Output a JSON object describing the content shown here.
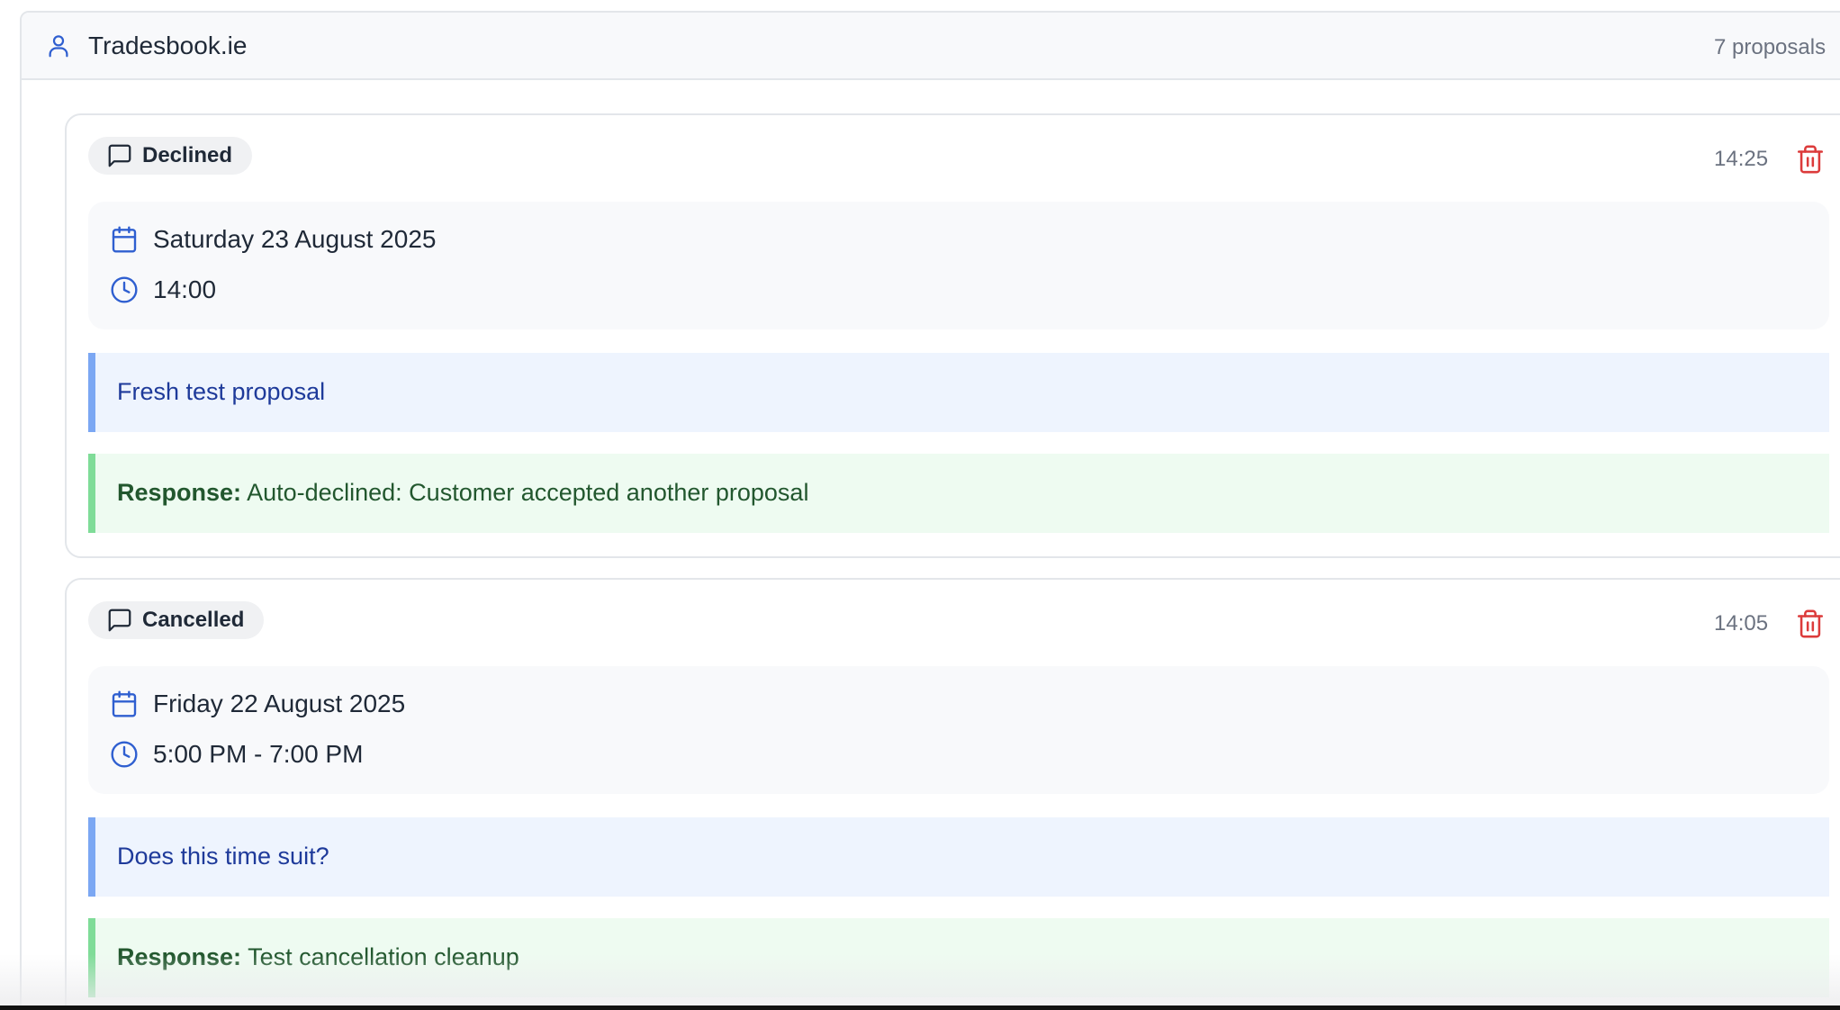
{
  "header": {
    "title": "Tradesbook.ie",
    "count": "7 proposals",
    "icon": "user-icon"
  },
  "colors": {
    "accent_blue": "#2f5fd0",
    "message_bg": "#eef4fe",
    "message_border": "#7ba7f3",
    "response_bg": "#eefbf1",
    "response_border": "#7fdc98",
    "delete_red": "#dc3b3b"
  },
  "proposals": [
    {
      "status": "Declined",
      "time": "14:25",
      "date": "Saturday 23 August 2025",
      "slot": "14:00",
      "message": "Fresh test proposal",
      "response_label": "Response:",
      "response": "Auto-declined: Customer accepted another proposal"
    },
    {
      "status": "Cancelled",
      "time": "14:05",
      "date": "Friday 22 August 2025",
      "slot": "5:00 PM - 7:00 PM",
      "message": "Does this time suit?",
      "response_label": "Response:",
      "response": "Test cancellation cleanup"
    }
  ]
}
